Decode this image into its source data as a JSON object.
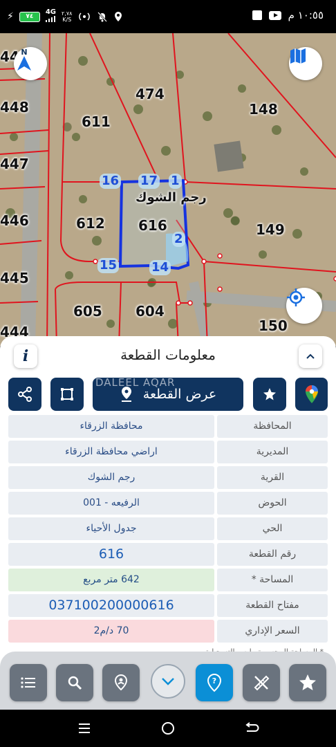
{
  "status_bar": {
    "time": "١٠:٥٥ م",
    "battery": "٧٤",
    "network": "4G",
    "speed_value": "٢,٧٨",
    "speed_unit": "K/S"
  },
  "map": {
    "lot_labels": [
      {
        "id": "l44",
        "text": "44"
      },
      {
        "id": "l448",
        "text": "448"
      },
      {
        "id": "l447",
        "text": "447"
      },
      {
        "id": "l446",
        "text": "446"
      },
      {
        "id": "l445",
        "text": "445"
      },
      {
        "id": "l444",
        "text": "444"
      },
      {
        "id": "l474",
        "text": "474"
      },
      {
        "id": "l611",
        "text": "611"
      },
      {
        "id": "l148",
        "text": "148"
      },
      {
        "id": "l612",
        "text": "612"
      },
      {
        "id": "l616",
        "text": "616"
      },
      {
        "id": "l149",
        "text": "149"
      },
      {
        "id": "l605",
        "text": "605"
      },
      {
        "id": "l604",
        "text": "604"
      },
      {
        "id": "l150",
        "text": "150"
      }
    ],
    "village_label": "رجم الشوك",
    "vertices": [
      "16",
      "17",
      "1",
      "2",
      "15",
      "14"
    ],
    "compass_letter": "N"
  },
  "panel": {
    "title": "معلومات القطعة",
    "info_letter": "i",
    "show_plot_label": "عرض القطعة",
    "watermark": "DALEEL AQAR",
    "rows": [
      {
        "label": "المحافظة",
        "value": "محافظة الزرقاء"
      },
      {
        "label": "المديرية",
        "value": "اراضي محافظة الزرقاء"
      },
      {
        "label": "القرية",
        "value": "رجم الشوك"
      },
      {
        "label": "الحوض",
        "value": "الرفيعه - 001"
      },
      {
        "label": "الحي",
        "value": "جدول الأحياء"
      },
      {
        "label": "رقم القطعة",
        "value": "616"
      },
      {
        "label": "المساحة *",
        "value": "642   متر مربع"
      },
      {
        "label": "مفتاح القطعة",
        "value": "037100200000616"
      },
      {
        "label": "السعر الإداري",
        "value": "70 د/م2"
      }
    ],
    "footnote": "* المساحة المحسوبة وليس التسجيلية"
  },
  "colors": {
    "accent_dark": "#10345f",
    "accent_blue": "#0b8fd6",
    "plot_outline": "#1533e0",
    "parcel_lines": "#e0141e"
  }
}
